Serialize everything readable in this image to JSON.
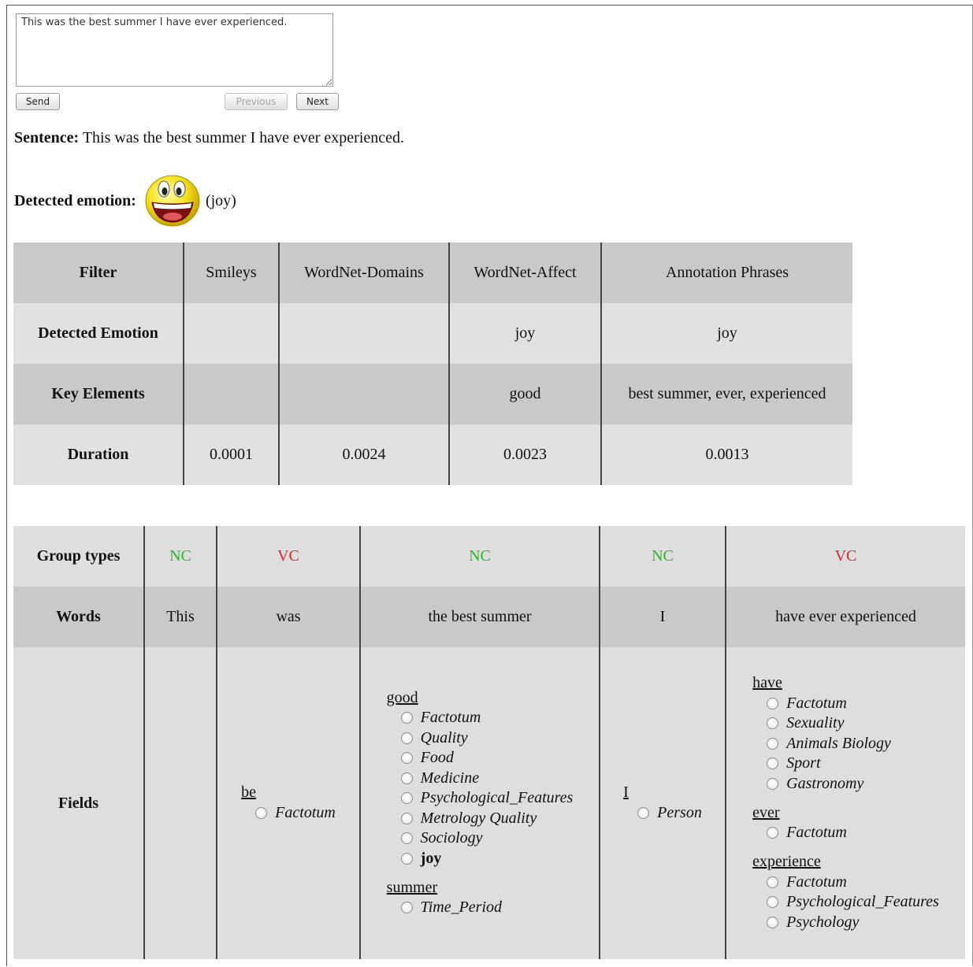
{
  "input": {
    "text": "This was the best summer I have ever experienced."
  },
  "buttons": {
    "send": "Send",
    "previous": "Previous",
    "next": "Next"
  },
  "sentence": {
    "label": "Sentence:",
    "text": "This was the best summer I have ever experienced."
  },
  "detected": {
    "label": "Detected emotion:",
    "emotion": "(joy)",
    "icon": "laughing-smiley-icon"
  },
  "filter_table": {
    "headers": [
      "Filter",
      "Smileys",
      "WordNet-Domains",
      "WordNet-Affect",
      "Annotation Phrases"
    ],
    "rows": [
      [
        "Detected Emotion",
        "",
        "",
        "joy",
        "joy"
      ],
      [
        "Key Elements",
        "",
        "",
        "good",
        "best summer, ever, experienced"
      ],
      [
        "Duration",
        "0.0001",
        "0.0024",
        "0.0023",
        "0.0013"
      ]
    ]
  },
  "group_table": {
    "row_labels": {
      "group_types": "Group types",
      "words": "Words",
      "fields": "Fields"
    },
    "groups": [
      {
        "type": "NC",
        "words": "This",
        "fields": []
      },
      {
        "type": "VC",
        "words": "was",
        "fields": [
          {
            "word": "be",
            "options": [
              "Factotum"
            ]
          }
        ]
      },
      {
        "type": "NC",
        "words": "the best summer",
        "fields": [
          {
            "word": "good",
            "options": [
              "Factotum",
              "Quality",
              "Food",
              "Medicine",
              "Psychological_Features",
              "Metrology Quality",
              "Sociology",
              "joy"
            ]
          },
          {
            "word": "summer",
            "options": [
              "Time_Period"
            ]
          }
        ]
      },
      {
        "type": "NC",
        "words": "I",
        "fields": [
          {
            "word": "I",
            "options": [
              "Person"
            ]
          }
        ]
      },
      {
        "type": "VC",
        "words": "have ever experienced",
        "fields": [
          {
            "word": "have",
            "options": [
              "Factotum",
              "Sexuality",
              "Animals Biology",
              "Sport",
              "Gastronomy"
            ]
          },
          {
            "word": "ever",
            "options": [
              "Factotum"
            ]
          },
          {
            "word": "experience",
            "options": [
              "Factotum",
              "Psychological_Features",
              "Psychology"
            ]
          }
        ]
      }
    ],
    "colors": {
      "NC": "#2bb52b",
      "VC": "#d42a2a"
    }
  }
}
